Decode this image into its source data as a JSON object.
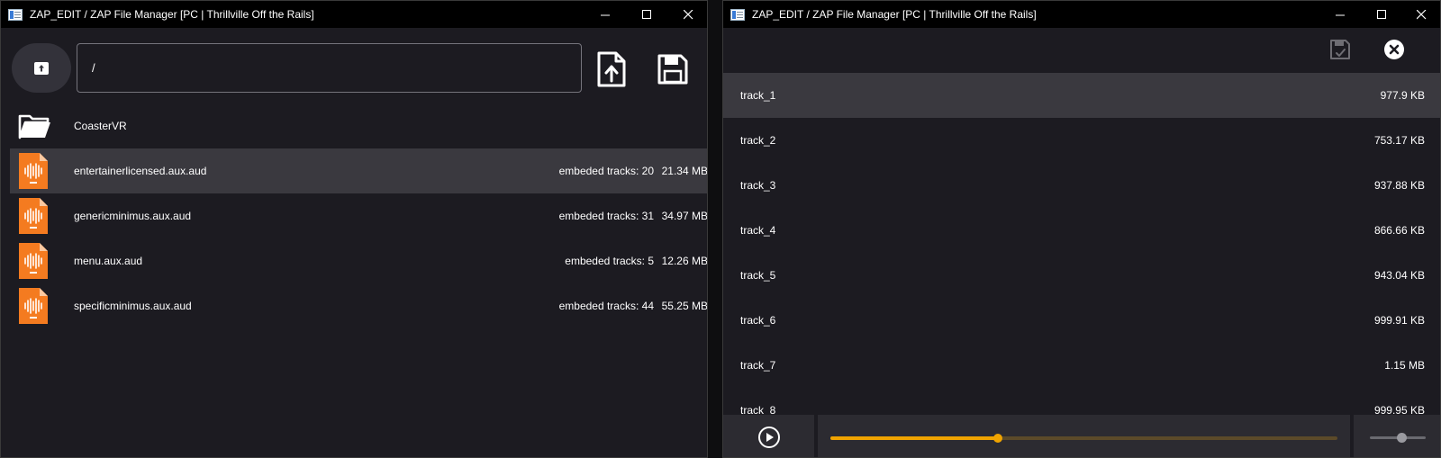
{
  "left_window": {
    "title": "ZAP_EDIT / ZAP File Manager  [PC | Thrillville Off the Rails]",
    "path_value": "/",
    "items": [
      {
        "name": "CoasterVR",
        "type": "folder",
        "tracks": "",
        "size": ""
      },
      {
        "name": "entertainerlicensed.aux.aud",
        "type": "audio-file",
        "tracks": "embeded tracks: 20",
        "size": "21.34 MB"
      },
      {
        "name": "genericminimus.aux.aud",
        "type": "audio-file",
        "tracks": "embeded tracks: 31",
        "size": "34.97 MB"
      },
      {
        "name": "menu.aux.aud",
        "type": "audio-file",
        "tracks": "embeded tracks: 5",
        "size": "12.26 MB"
      },
      {
        "name": "specificminimus.aux.aud",
        "type": "audio-file",
        "tracks": "embeded tracks: 44",
        "size": "55.25 MB"
      }
    ],
    "selected_index": 1
  },
  "right_window": {
    "title": "ZAP_EDIT / ZAP File Manager  [PC | Thrillville Off the Rails]",
    "tracks": [
      {
        "name": "track_1",
        "size": "977.9 KB"
      },
      {
        "name": "track_2",
        "size": "753.17 KB"
      },
      {
        "name": "track_3",
        "size": "937.88 KB"
      },
      {
        "name": "track_4",
        "size": "866.66 KB"
      },
      {
        "name": "track_5",
        "size": "943.04 KB"
      },
      {
        "name": "track_6",
        "size": "999.91 KB"
      },
      {
        "name": "track_7",
        "size": "1.15 MB"
      },
      {
        "name": "track_8",
        "size": "999.95 KB"
      }
    ],
    "selected_index": 0,
    "player": {
      "seek_fraction": 0.33,
      "volume_fraction": 0.57
    }
  },
  "icons": {
    "up": "folder-up-icon",
    "upload": "file-upload-icon",
    "save": "save-icon",
    "save_check": "save-check-icon",
    "close": "close-circle-icon",
    "play": "play-icon",
    "folder": "folder-icon",
    "audio": "audio-file-icon"
  },
  "colors": {
    "accent": "#f0a400",
    "audio_icon": "#f47b20",
    "background": "#1c1b21",
    "selected_row": "#3a393f"
  }
}
